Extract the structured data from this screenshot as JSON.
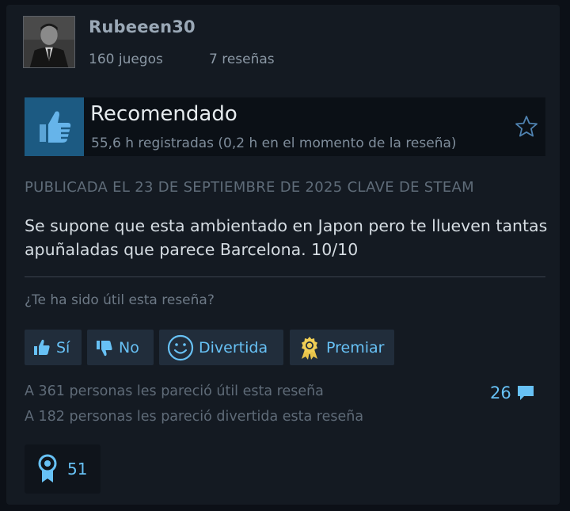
{
  "user": {
    "name": "Rubeeen30",
    "games": "160 juegos",
    "reviews": "7 reseñas"
  },
  "recommendation": {
    "title": "Recomendado",
    "hours": "55,6 h registradas (0,2 h en el momento de la reseña)",
    "icon": "thumbs-up-icon"
  },
  "review": {
    "posted": "PUBLICADA EL 23 DE SEPTIEMBRE DE 2025 CLAVE DE STEAM",
    "text": "Se supone que esta ambientado en Japon pero te llueven tantas apuñaladas que parece Barcelona. 10/10"
  },
  "feedback": {
    "question": "¿Te ha sido útil esta reseña?",
    "yes": "Sí",
    "no": "No",
    "funny": "Divertida",
    "award": "Premiar"
  },
  "stats": {
    "helpful": "A 361 personas les pareció útil esta reseña",
    "funny": "A 182 personas les pareció divertida esta reseña",
    "comments": "26",
    "awards": "51"
  },
  "colors": {
    "accent": "#67c1f5",
    "thumb_box": "#1c5a82",
    "button_bg": "#212d3b",
    "award_gold": "#e8c34a"
  }
}
